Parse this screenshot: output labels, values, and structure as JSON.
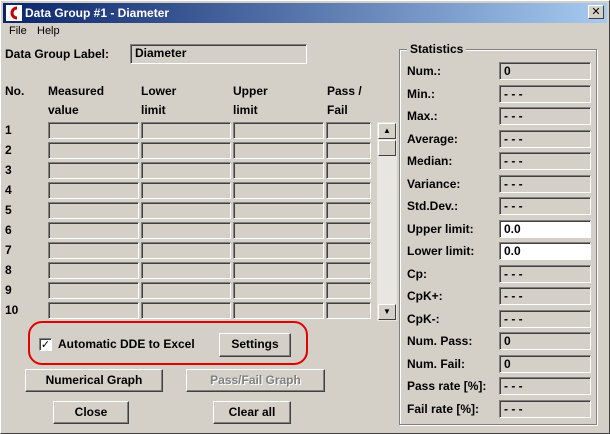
{
  "window": {
    "title": "Data Group #1 - Diameter",
    "close_glyph": "✕"
  },
  "menu": [
    {
      "label": "File"
    },
    {
      "label": "Help"
    }
  ],
  "group_label": {
    "label": "Data Group Label:",
    "value": "Diameter"
  },
  "table": {
    "headers": {
      "no": "No.",
      "measured_1": "Measured",
      "measured_2": "value",
      "lower_1": "Lower",
      "lower_2": "limit",
      "upper_1": "Upper",
      "upper_2": "limit",
      "pass_1": "Pass /",
      "pass_2": "Fail"
    },
    "rows": [
      "1",
      "2",
      "3",
      "4",
      "5",
      "6",
      "7",
      "8",
      "9",
      "10"
    ]
  },
  "scrollbar": {
    "up_glyph": "▲",
    "down_glyph": "▼"
  },
  "dde": {
    "checkbox_label": "Automatic DDE to Excel",
    "checked_glyph": "✓",
    "settings_label": "Settings"
  },
  "buttons": {
    "numerical_graph": "Numerical Graph",
    "pass_fail_graph": "Pass/Fail Graph",
    "close": "Close",
    "clear_all": "Clear all"
  },
  "statistics": {
    "title": "Statistics",
    "items": [
      {
        "label": "Num.:",
        "value": "0",
        "editable": false
      },
      {
        "label": "Min.:",
        "value": "- - -",
        "editable": false
      },
      {
        "label": "Max.:",
        "value": "- - -",
        "editable": false
      },
      {
        "label": "Average:",
        "value": "- - -",
        "editable": false
      },
      {
        "label": "Median:",
        "value": "- - -",
        "editable": false
      },
      {
        "label": "Variance:",
        "value": "- - -",
        "editable": false
      },
      {
        "label": "Std.Dev.:",
        "value": "- - -",
        "editable": false
      },
      {
        "label": "Upper limit:",
        "value": "0.0",
        "editable": true
      },
      {
        "label": "Lower limit:",
        "value": "0.0",
        "editable": true
      },
      {
        "label": "Cp:",
        "value": "- - -",
        "editable": false
      },
      {
        "label": "CpK+:",
        "value": "- - -",
        "editable": false
      },
      {
        "label": "CpK-:",
        "value": "- - -",
        "editable": false
      },
      {
        "label": "Num. Pass:",
        "value": "0",
        "editable": false
      },
      {
        "label": "Num. Fail:",
        "value": "0",
        "editable": false
      },
      {
        "label": "Pass rate [%]:",
        "value": "- - -",
        "editable": false
      },
      {
        "label": "Fail rate [%]:",
        "value": "- - -",
        "editable": false
      }
    ]
  },
  "colors": {
    "title_bar_start": "#0a246a",
    "title_bar_end": "#a6caf0",
    "highlight": "#e00000",
    "face": "#d4d0c8"
  }
}
